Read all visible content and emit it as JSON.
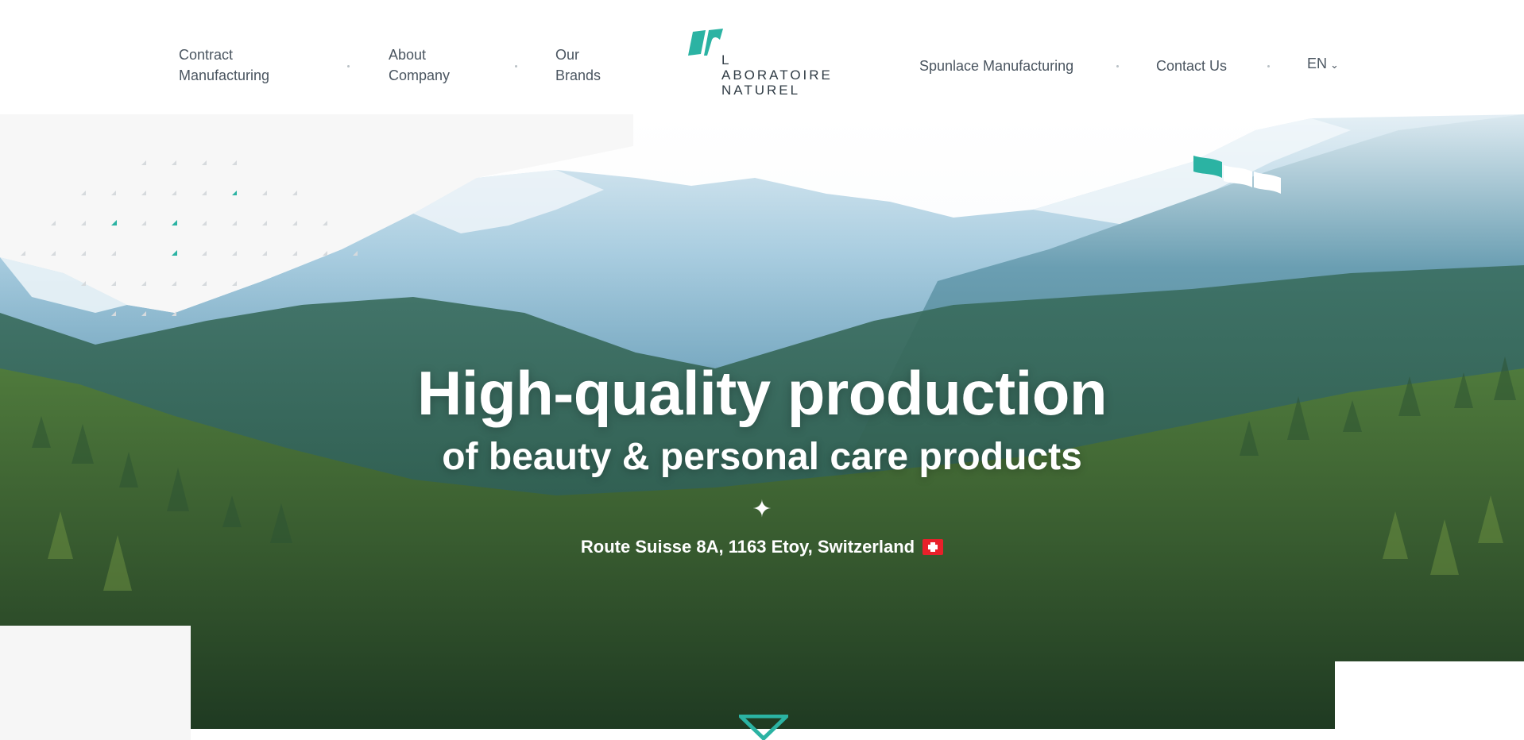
{
  "header": {
    "nav_left": [
      {
        "line1": "Contract",
        "line2": "Manufacturing"
      },
      {
        "line1": "About",
        "line2": "Company"
      },
      {
        "line1": "Our",
        "line2": "Brands"
      }
    ],
    "logo": {
      "line1": "L ABORATOIRE",
      "line2": "NATUREL"
    },
    "nav_right": [
      {
        "label": "Spunlace Manufacturing"
      },
      {
        "label": "Contact Us"
      }
    ],
    "language": "EN"
  },
  "hero": {
    "title": "High-quality production",
    "subtitle": "of beauty & personal care products",
    "divider_glyph": "✦",
    "address": "Route Suisse 8A, 1163 Etoy, Switzerland",
    "flag_icon": "swiss-flag-icon"
  },
  "colors": {
    "accent": "#2bb3a3",
    "text": "#4a5560",
    "panel_grey": "#f6f6f6"
  }
}
